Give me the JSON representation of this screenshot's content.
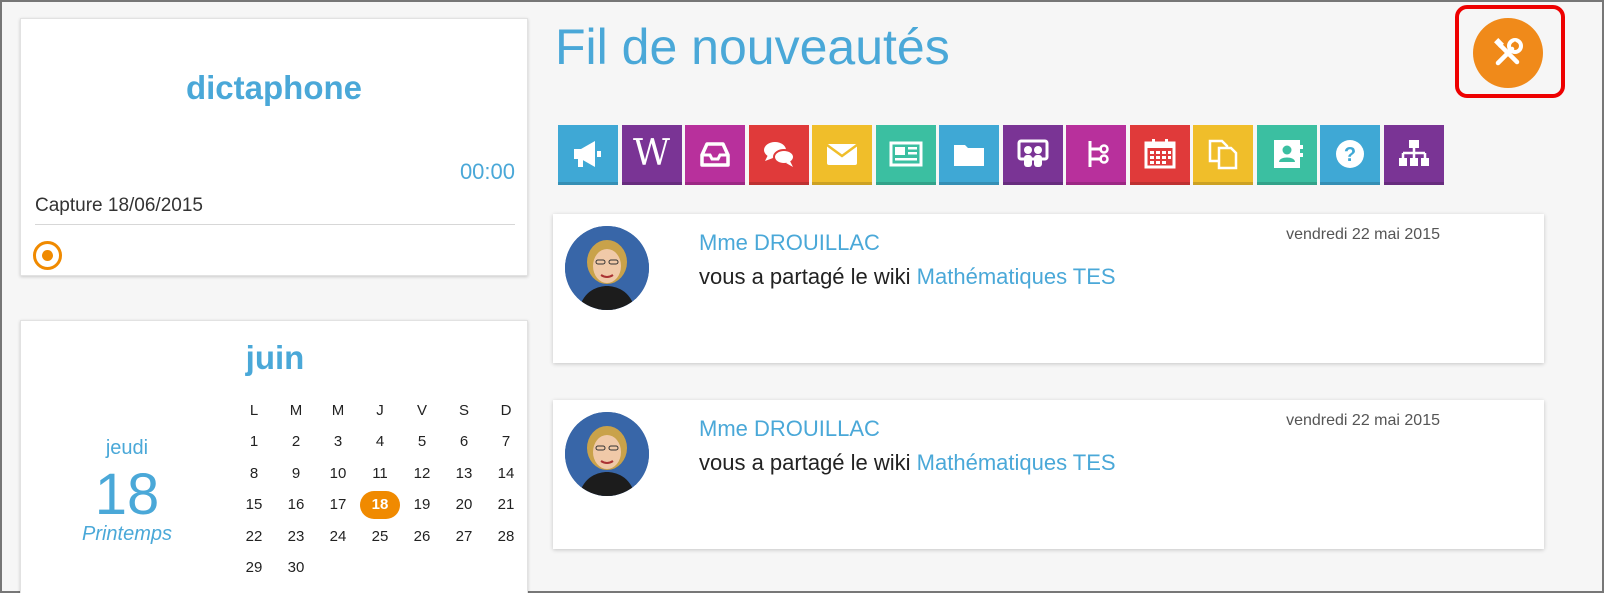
{
  "dictaphone": {
    "title": "dictaphone",
    "time": "00:00",
    "caption": "Capture 18/06/2015"
  },
  "calendar": {
    "month": "juin",
    "day_name": "jeudi",
    "day_number": "18",
    "season": "Printemps",
    "weekdays": [
      "L",
      "M",
      "M",
      "J",
      "V",
      "S",
      "D"
    ],
    "weeks": [
      [
        "1",
        "2",
        "3",
        "4",
        "5",
        "6",
        "7"
      ],
      [
        "8",
        "9",
        "10",
        "11",
        "12",
        "13",
        "14"
      ],
      [
        "15",
        "16",
        "17",
        "18",
        "19",
        "20",
        "21"
      ],
      [
        "22",
        "23",
        "24",
        "25",
        "26",
        "27",
        "28"
      ],
      [
        "29",
        "30",
        "",
        "",
        "",
        "",
        ""
      ]
    ],
    "today": "18"
  },
  "header": {
    "title": "Fil de nouveautés"
  },
  "apps": [
    {
      "name": "actualites",
      "icon": "megaphone-icon",
      "color": "#3fa8d5"
    },
    {
      "name": "wiki",
      "icon": "wiki-icon",
      "color": "#7a3495"
    },
    {
      "name": "casier",
      "icon": "inbox-icon",
      "color": "#b8309c"
    },
    {
      "name": "forum",
      "icon": "chat-icon",
      "color": "#e03a3a"
    },
    {
      "name": "messagerie",
      "icon": "envelope-icon",
      "color": "#f0be2a"
    },
    {
      "name": "blog",
      "icon": "newspaper-icon",
      "color": "#3bbfa1"
    },
    {
      "name": "espace-documentaire",
      "icon": "folder-icon",
      "color": "#3fa8d5"
    },
    {
      "name": "communautes",
      "icon": "community-icon",
      "color": "#7a3495"
    },
    {
      "name": "carte-mentale",
      "icon": "mindmap-icon",
      "color": "#b8309c"
    },
    {
      "name": "agenda",
      "icon": "calendar-icon",
      "color": "#e03a3a"
    },
    {
      "name": "pages",
      "icon": "pages-icon",
      "color": "#f0be2a"
    },
    {
      "name": "annuaire",
      "icon": "contact-card-icon",
      "color": "#3bbfa1"
    },
    {
      "name": "aide",
      "icon": "help-icon",
      "color": "#3fa8d5"
    },
    {
      "name": "administration",
      "icon": "sitemap-icon",
      "color": "#7a3495"
    }
  ],
  "posts": [
    {
      "author": "Mme DROUILLAC",
      "date": "vendredi 22 mai 2015",
      "text": "vous a partagé le wiki ",
      "link": "Mathématiques TES"
    },
    {
      "author": "Mme DROUILLAC",
      "date": "vendredi 22 mai 2015",
      "text": "vous a partagé le wiki ",
      "link": "Mathématiques TES"
    }
  ],
  "colors": {
    "accent_blue": "#4aa8d8",
    "accent_orange": "#f08a00",
    "highlight_red": "#e00000"
  }
}
